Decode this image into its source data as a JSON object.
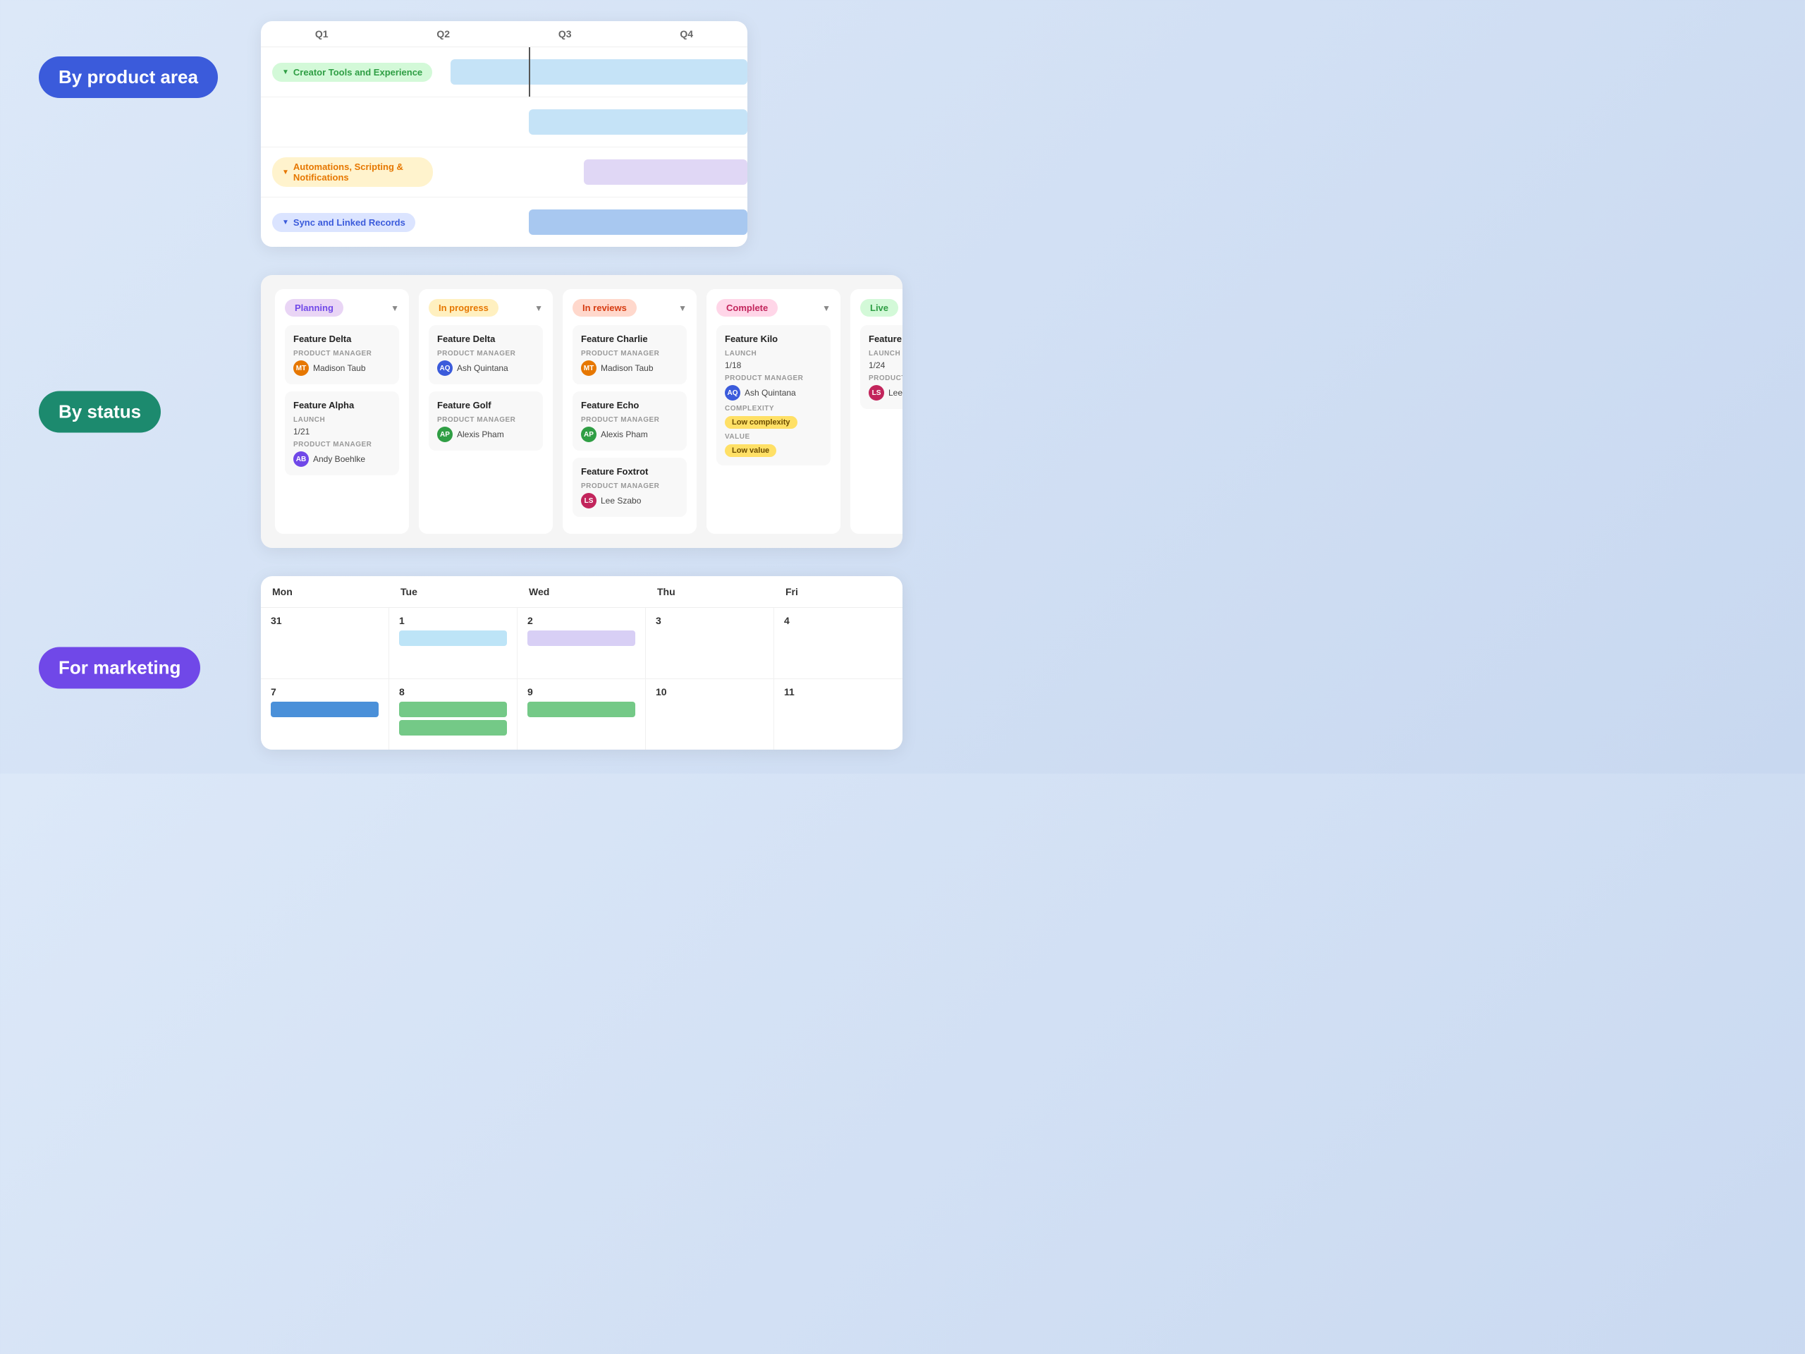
{
  "section1": {
    "label": "By product area",
    "gantt": {
      "quarters": [
        "Q1",
        "Q2",
        "Q3",
        "Q4"
      ],
      "rows": [
        {
          "group": "Creator Tools and Experience",
          "group_color": "green",
          "bar_offset": "10%",
          "bar_width": "80%",
          "bar_color": "light-blue"
        },
        {
          "group": "",
          "bar_offset": "28%",
          "bar_width": "70%",
          "bar_color": "light-blue"
        },
        {
          "group": "Automations, Scripting & Notifications",
          "group_color": "orange",
          "bar_offset": "46%",
          "bar_width": "54%",
          "bar_color": "light-purple"
        },
        {
          "group": "Sync and Linked Records",
          "group_color": "blue",
          "bar_offset": "28%",
          "bar_width": "72%",
          "bar_color": "blue-mid"
        }
      ]
    }
  },
  "section2": {
    "label": "By status",
    "columns": [
      {
        "status": "Planning",
        "badge_class": "planning",
        "items": [
          {
            "title": "Feature Delta",
            "meta": [
              {
                "label": "PRODUCT MANAGER",
                "value": "Madison Taub",
                "avatar": "mt"
              }
            ]
          },
          {
            "title": "Feature Alpha",
            "meta": [
              {
                "label": "LAUNCH",
                "value": "1/21"
              },
              {
                "label": "PRODUCT MANAGER",
                "value": "Andy Boehlke",
                "avatar": "ab"
              }
            ]
          }
        ]
      },
      {
        "status": "In progress",
        "badge_class": "in-progress",
        "items": [
          {
            "title": "Feature Delta",
            "meta": [
              {
                "label": "PRODUCT MANAGER",
                "value": "Ash Quintana",
                "avatar": "aq"
              }
            ]
          },
          {
            "title": "Feature Golf",
            "meta": [
              {
                "label": "PRODUCT MANAGER",
                "value": "Alexis Pham",
                "avatar": "ap"
              }
            ]
          }
        ]
      },
      {
        "status": "In reviews",
        "badge_class": "in-reviews",
        "items": [
          {
            "title": "Feature Charlie",
            "meta": [
              {
                "label": "PRODUCT MANAGER",
                "value": "Madison Taub",
                "avatar": "mt"
              }
            ]
          },
          {
            "title": "Feature Echo",
            "meta": [
              {
                "label": "PRODUCT MANAGER",
                "value": "Alexis Pham",
                "avatar": "ap"
              }
            ]
          },
          {
            "title": "Feature Foxtrot",
            "meta": [
              {
                "label": "PRODUCT MANAGER",
                "value": "Lee Szabo",
                "avatar": "ls"
              }
            ]
          }
        ]
      },
      {
        "status": "Complete",
        "badge_class": "complete",
        "items": [
          {
            "title": "Feature Kilo",
            "meta": [
              {
                "label": "LAUNCH",
                "value": "1/18"
              },
              {
                "label": "PRODUCT MANAGER",
                "value": "Ash Quintana",
                "avatar": "aq"
              },
              {
                "label": "COMPLEXITY",
                "value": "Low complexity",
                "badge": "low"
              },
              {
                "label": "VALUE",
                "value": "Low value",
                "value_badge": true
              }
            ]
          }
        ]
      },
      {
        "status": "Live",
        "badge_class": "live",
        "items": [
          {
            "title": "Feature Juliett",
            "meta": [
              {
                "label": "LAUNCH",
                "value": "1/24"
              },
              {
                "label": "PRODUCT MANAGER",
                "value": "Lee Szabo",
                "avatar": "ls"
              }
            ]
          }
        ]
      }
    ]
  },
  "section3": {
    "label": "For marketing",
    "calendar": {
      "headers": [
        "Mon",
        "Tue",
        "Wed",
        "Thu",
        "Fri"
      ],
      "weeks": [
        {
          "dates": [
            "31",
            "1",
            "2",
            "3",
            "4"
          ],
          "events": [
            {
              "col": 1,
              "color": "light-blue"
            },
            {
              "col": 2,
              "color": "light-purple"
            }
          ]
        },
        {
          "dates": [
            "7",
            "8",
            "9",
            "10",
            "11"
          ],
          "events": [
            {
              "col": 0,
              "color": "blue"
            },
            {
              "col": 1,
              "color": "green"
            },
            {
              "col": 1,
              "color": "green"
            },
            {
              "col": 2,
              "color": "green"
            }
          ]
        }
      ]
    }
  }
}
